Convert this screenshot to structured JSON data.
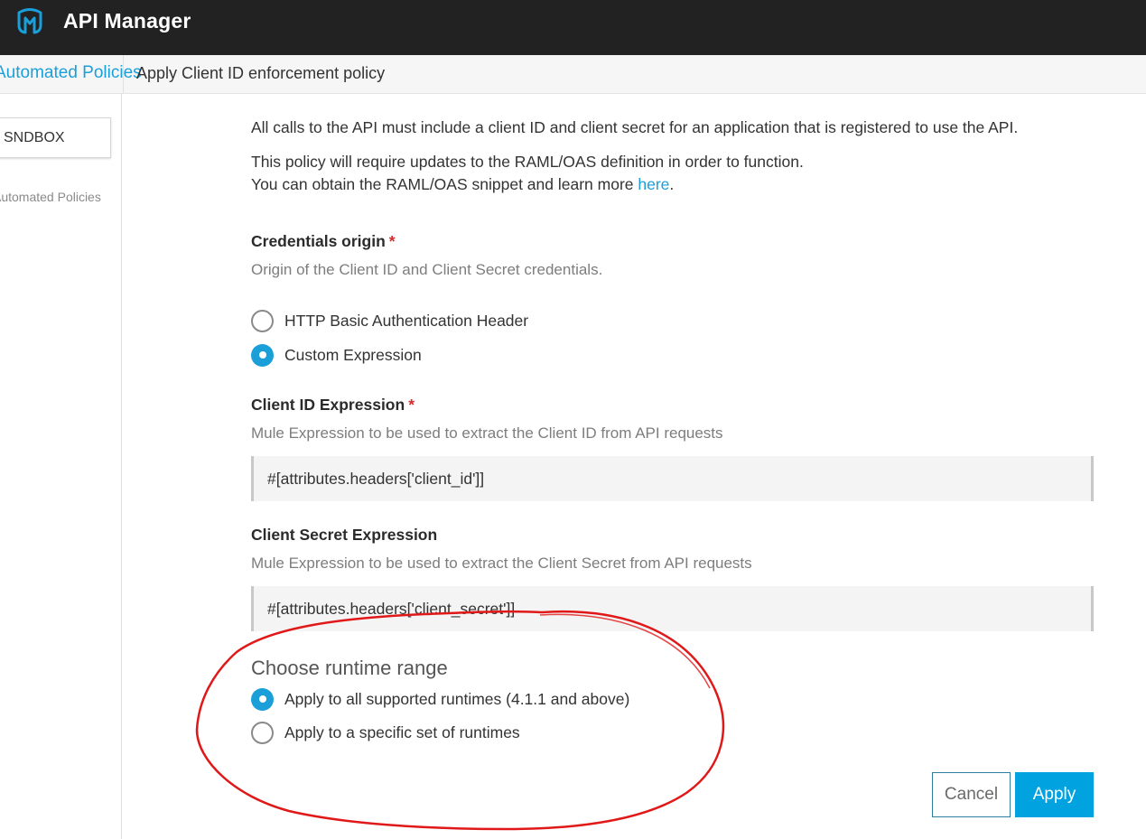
{
  "header": {
    "app_title": "API Manager",
    "logo_icon": "mulesoft-logo-icon",
    "bg_color": "#222222"
  },
  "breadcrumb": {
    "parent": "Automated Policies",
    "current": "Apply Client ID enforcement policy"
  },
  "sidebar": {
    "environment": "SNDBOX",
    "items": [
      {
        "label": "Automated Policies"
      }
    ]
  },
  "main": {
    "description": "All calls to the API must include a client ID and client secret for an application that is registered to use the API.",
    "note_line1": "This policy will require updates to the RAML/OAS definition in order to function.",
    "note_line2_prefix": "You can obtain the RAML/OAS snippet and learn more ",
    "note_link": "here",
    "note_line2_suffix": ".",
    "credentials_origin": {
      "title": "Credentials origin",
      "required_mark": "*",
      "subtitle": "Origin of the Client ID and Client Secret credentials.",
      "options": [
        {
          "label": "HTTP Basic Authentication Header",
          "selected": false
        },
        {
          "label": "Custom Expression",
          "selected": true
        }
      ]
    },
    "client_id_expression": {
      "title": "Client ID Expression",
      "required_mark": "*",
      "subtitle": "Mule Expression to be used to extract the Client ID from API requests",
      "value": "#[attributes.headers['client_id']]"
    },
    "client_secret_expression": {
      "title": "Client Secret Expression",
      "subtitle": "Mule Expression to be used to extract the Client Secret from API requests",
      "value": "#[attributes.headers['client_secret']]"
    },
    "runtime_range": {
      "title": "Choose runtime range",
      "options": [
        {
          "label": "Apply to all supported runtimes (4.1.1 and above)",
          "selected": true
        },
        {
          "label": "Apply to a specific set of runtimes",
          "selected": false
        }
      ]
    }
  },
  "buttons": {
    "cancel": "Cancel",
    "apply": "Apply"
  },
  "colors": {
    "accent": "#00a2df",
    "link": "#1a9fd9",
    "required": "#d22d2d",
    "annotation": "#e01818"
  }
}
